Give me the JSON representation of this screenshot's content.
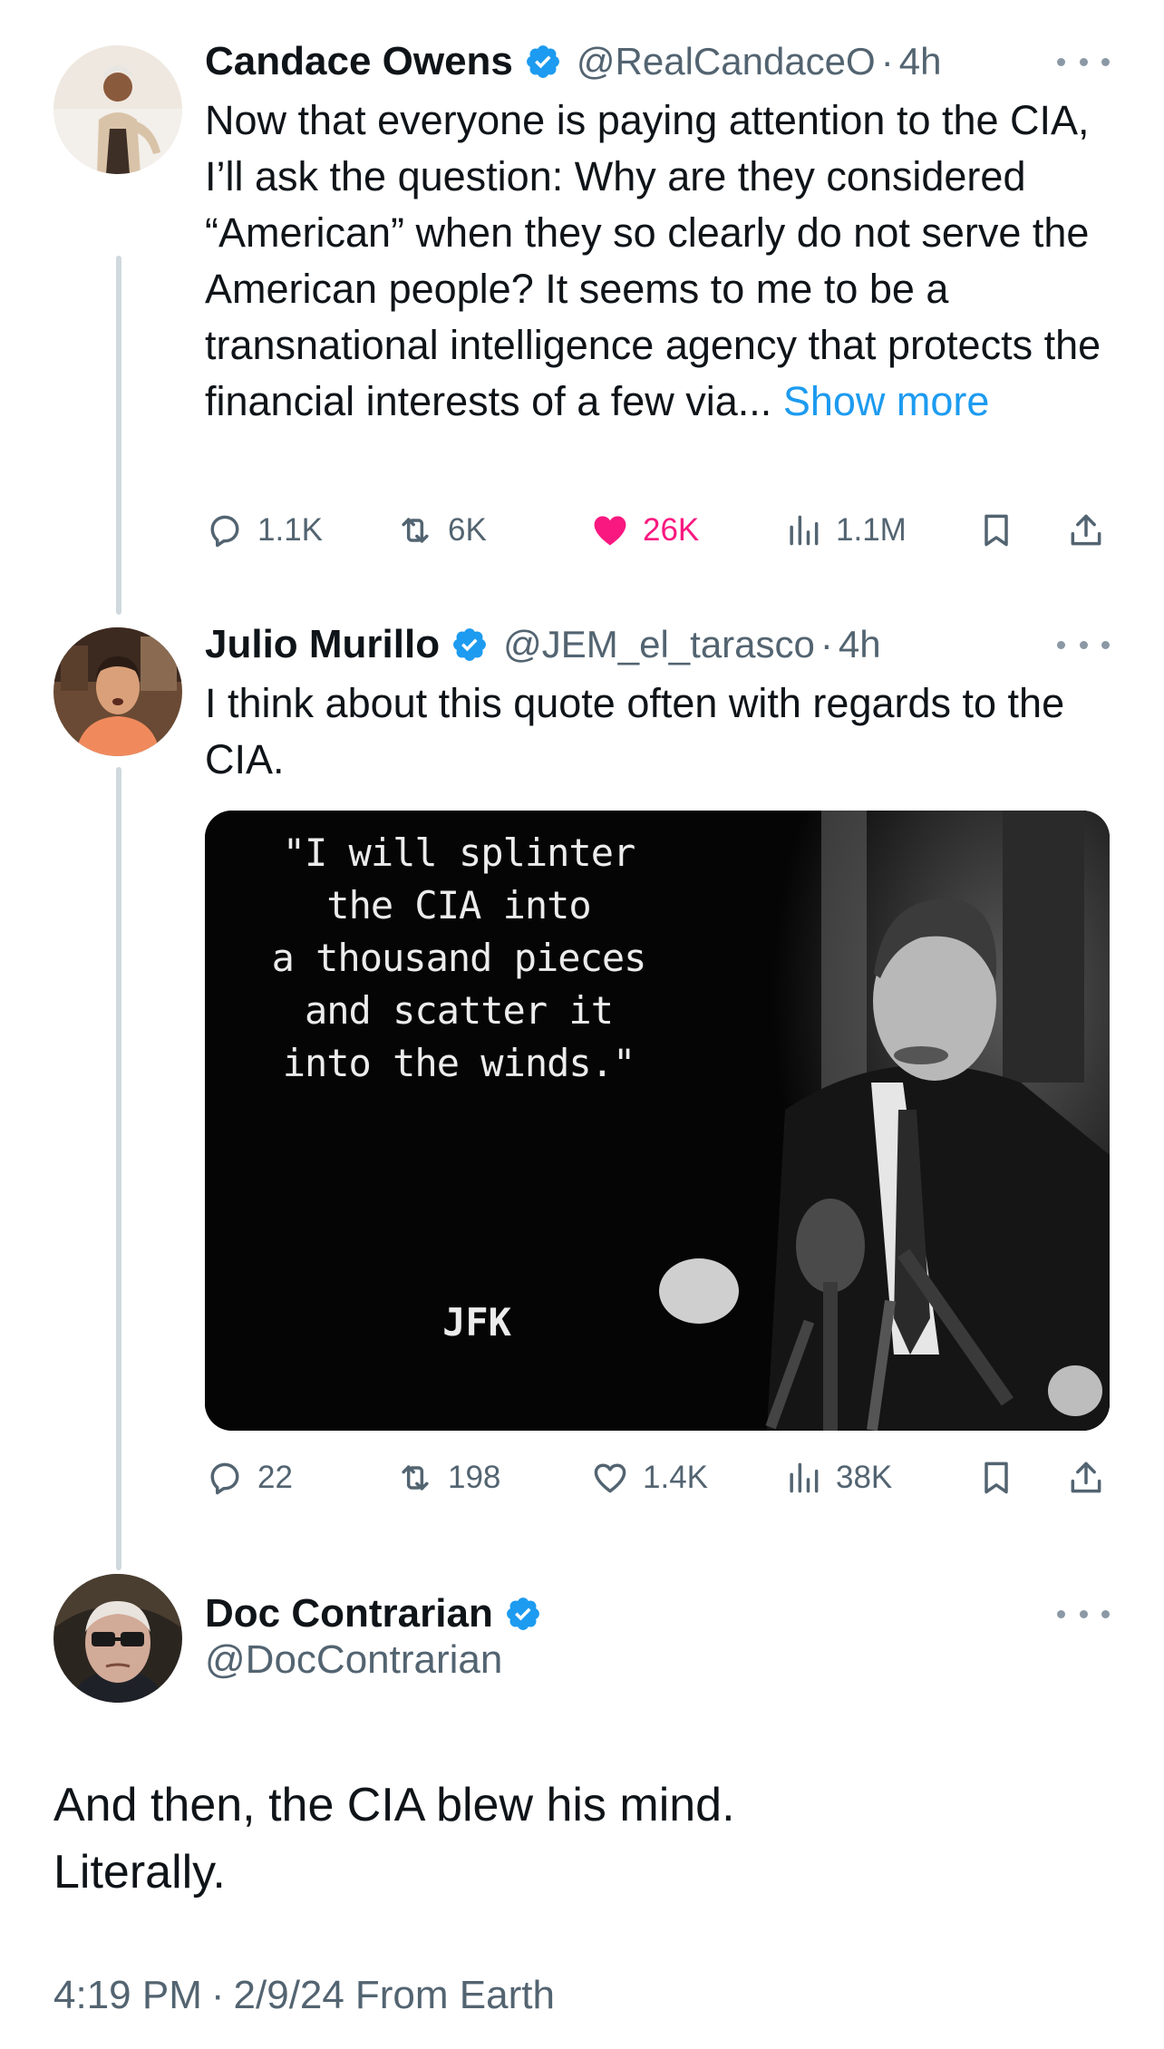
{
  "colors": {
    "accent": "#1d9bf0",
    "like": "#f91880",
    "muted": "#536471",
    "thread": "#cfd9de"
  },
  "tweets": [
    {
      "name": "Candace Owens",
      "handle": "@RealCandaceO",
      "separator": "·",
      "time": "4h",
      "text": "Now that everyone is paying attention to the CIA, I’ll ask the question: Why are they considered “American” when they so clearly do not serve the American people? It seems to me to be a transnational intelligence agency that protects the financial interests of a few via...",
      "show_more": "Show more",
      "replies": "1.1K",
      "reposts": "6K",
      "likes": "26K",
      "liked": true,
      "views": "1.1M"
    },
    {
      "name": "Julio Murillo",
      "handle": "@JEM_el_tarasco",
      "separator": "·",
      "time": "4h",
      "text": "I think about this quote often with regards to the CIA.",
      "image_quote": "\"I will splinter\nthe CIA into\na thousand pieces\nand scatter it\ninto the winds.\"",
      "image_attribution": "JFK",
      "replies": "22",
      "reposts": "198",
      "likes": "1.4K",
      "liked": false,
      "views": "38K"
    }
  ],
  "main_tweet": {
    "name": "Doc Contrarian",
    "handle": "@DocContrarian",
    "text": "And then, the CIA blew his mind. Literally.",
    "time": "4:19 PM",
    "separator": "·",
    "date": "2/9/24",
    "location": "From Earth"
  }
}
